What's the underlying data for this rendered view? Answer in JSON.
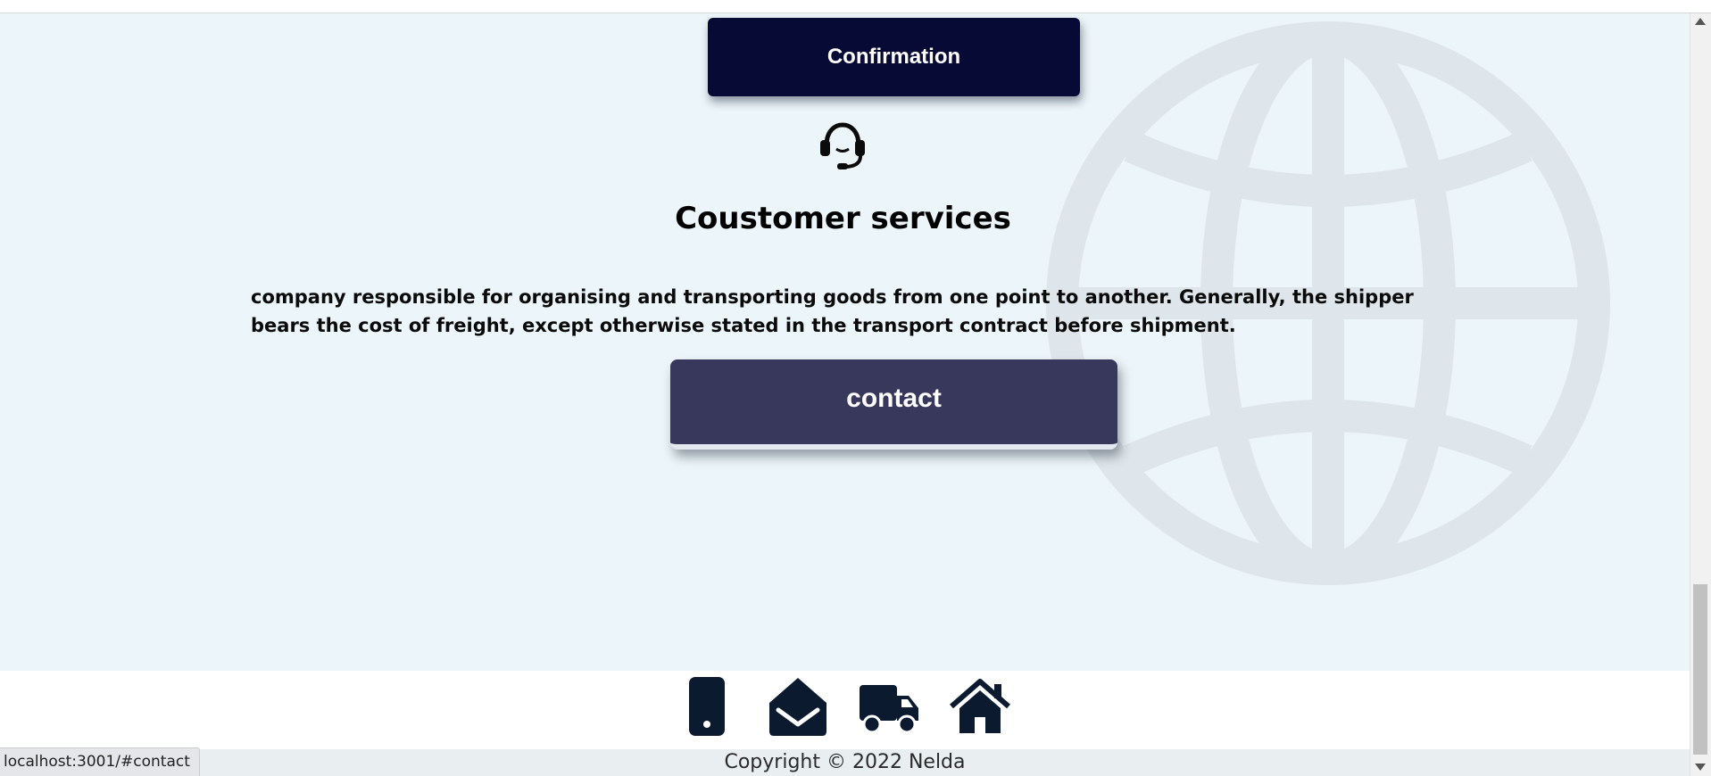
{
  "buttons": {
    "confirmation_label": "Confirmation",
    "contact_label": "contact"
  },
  "service": {
    "icon": "headset-icon",
    "title": "Coustomer services",
    "description": "company responsible for organising and transporting goods from one point to another. Generally, the shipper bears the cost of freight, except otherwise stated in the transport contract before shipment."
  },
  "footer": {
    "icons": [
      "phone-icon",
      "envelope-open-icon",
      "truck-icon",
      "home-icon"
    ],
    "copyright": "Copyright © 2022 Nelda"
  },
  "status_bar": {
    "url": "localhost:3001/#contact"
  },
  "colors": {
    "page_background": "#ecf5f9",
    "confirm_button": "#070a35",
    "contact_button": "#38385c",
    "footer_icon": "#0b1a2e",
    "globe_watermark": "#dee6eb"
  }
}
